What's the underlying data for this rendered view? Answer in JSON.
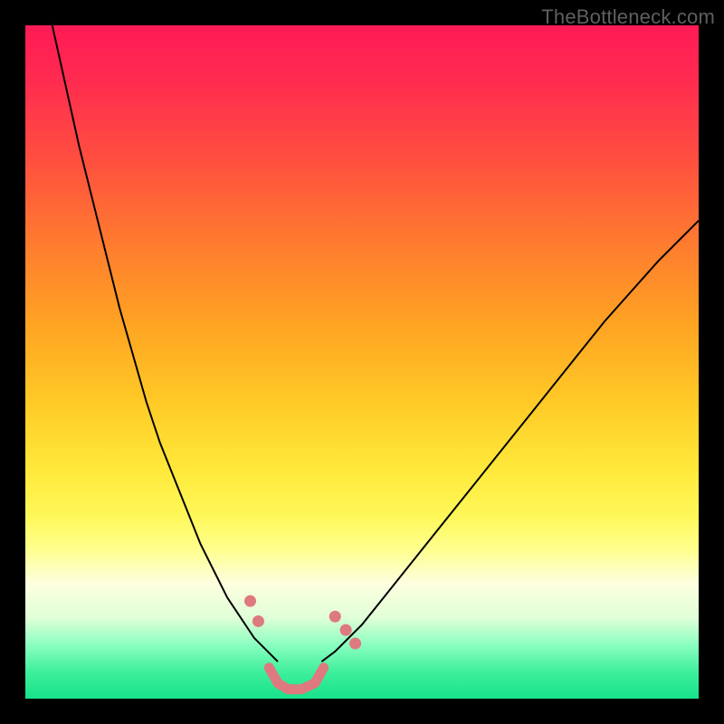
{
  "watermark": "TheBottleneck.com",
  "chart_data": {
    "type": "line",
    "title": "",
    "xlabel": "",
    "ylabel": "",
    "xlim": [
      0,
      100
    ],
    "ylim": [
      0,
      100
    ],
    "grid": false,
    "legend": false,
    "background_gradient": {
      "top": "#ff1a55",
      "mid": "#ffe93a",
      "bottom": "#17e28a"
    },
    "series": [
      {
        "name": "left-curve",
        "color": "#000000",
        "stroke_width": 2,
        "x": [
          4,
          6,
          8,
          10,
          12,
          14,
          16,
          18,
          20,
          22,
          24,
          26,
          28,
          30,
          32,
          34,
          36,
          37.5
        ],
        "y": [
          100,
          91,
          82,
          74,
          66,
          58,
          51,
          44,
          38,
          33,
          28,
          23,
          19,
          15,
          12,
          9,
          7,
          5.5
        ]
      },
      {
        "name": "right-curve",
        "color": "#000000",
        "stroke_width": 2,
        "x": [
          44,
          46,
          50,
          54,
          58,
          62,
          66,
          70,
          74,
          78,
          82,
          86,
          90,
          94,
          98,
          100
        ],
        "y": [
          5.5,
          7,
          11,
          16,
          21,
          26,
          31,
          36,
          41,
          46,
          51,
          56,
          60.5,
          65,
          69,
          71
        ]
      },
      {
        "name": "valley-floor",
        "color": "#de7a7f",
        "stroke_width": 11,
        "linecap": "round",
        "x": [
          36.2,
          37.5,
          39,
          41,
          43,
          44.3
        ],
        "y": [
          4.6,
          2.3,
          1.4,
          1.4,
          2.3,
          4.6
        ]
      },
      {
        "name": "left-valley-markers",
        "type": "scatter",
        "color": "#de7a7f",
        "marker_radius": 6.5,
        "x": [
          33.4,
          34.6
        ],
        "y": [
          14.5,
          11.5
        ]
      },
      {
        "name": "right-valley-markers",
        "type": "scatter",
        "color": "#de7a7f",
        "marker_radius": 6.5,
        "x": [
          46.0,
          47.6,
          49.0
        ],
        "y": [
          12.2,
          10.2,
          8.2
        ]
      }
    ]
  }
}
